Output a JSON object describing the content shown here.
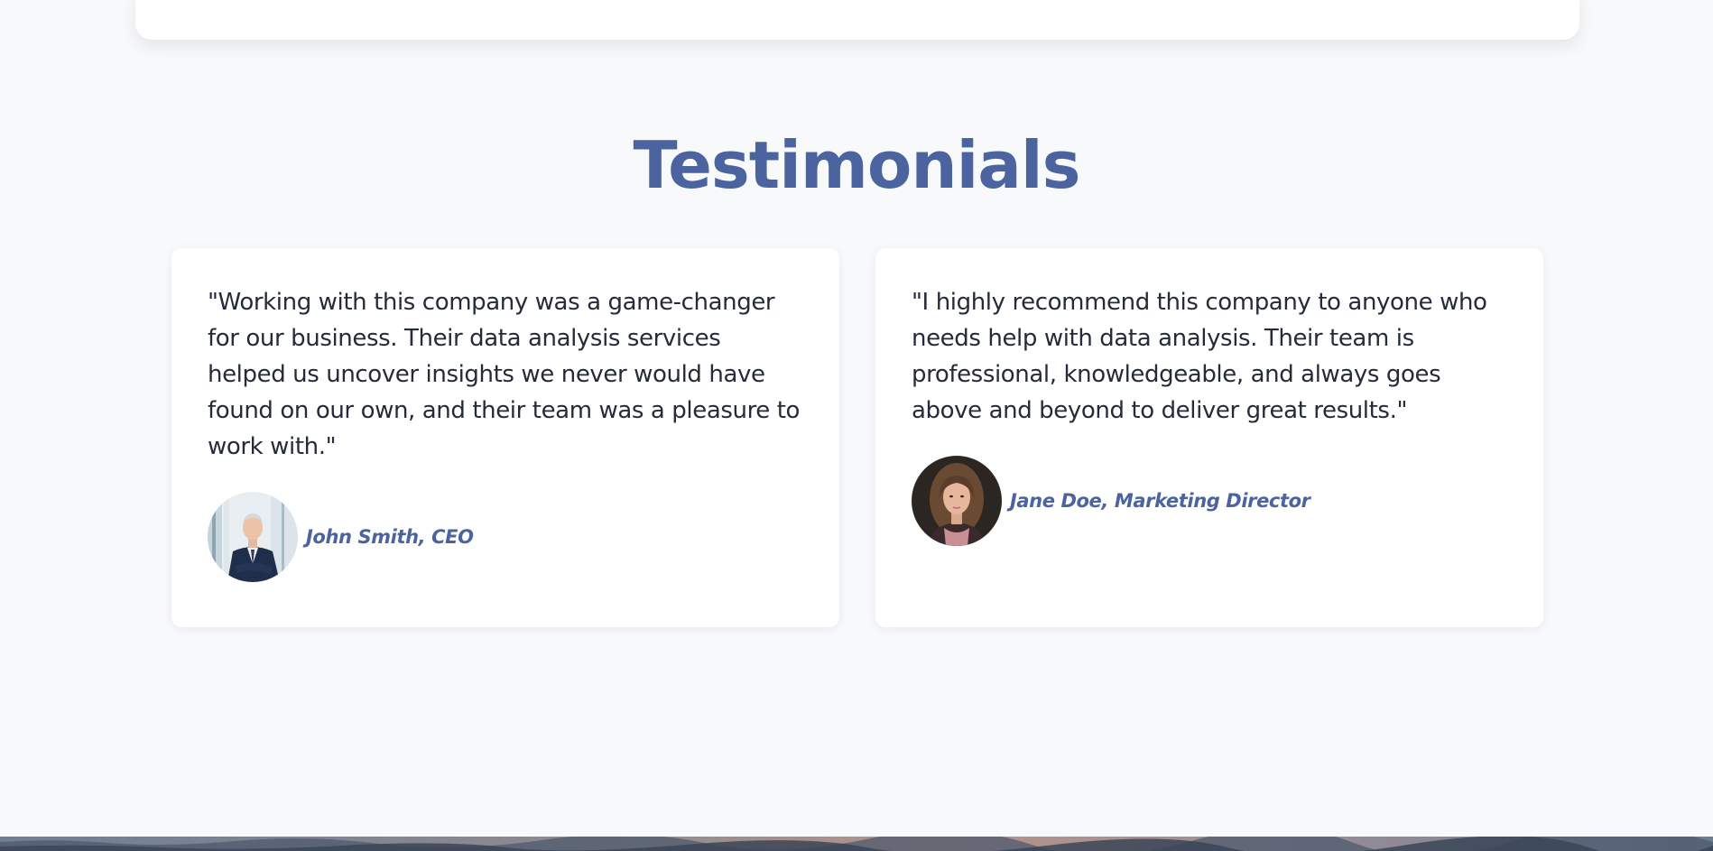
{
  "section": {
    "title": "Testimonials"
  },
  "testimonials": [
    {
      "quote": "\"Working with this company was a game-changer for our business. Their data analysis services helped us uncover insights we never would have found on our own, and their team was a pleasure to work with.\"",
      "author": "John Smith, CEO",
      "avatar": "man-in-suit-photo"
    },
    {
      "quote": "\"I highly recommend this company to anyone who needs help with data analysis. Their team is professional, knowledgeable, and always goes above and beyond to deliver great results.\"",
      "author": "Jane Doe, Marketing Director",
      "avatar": "woman-portrait-photo"
    }
  ],
  "colors": {
    "page_background": "#f8f9fb",
    "accent": "#4b64a0",
    "body_text": "#252b3a",
    "card_background": "#ffffff"
  }
}
